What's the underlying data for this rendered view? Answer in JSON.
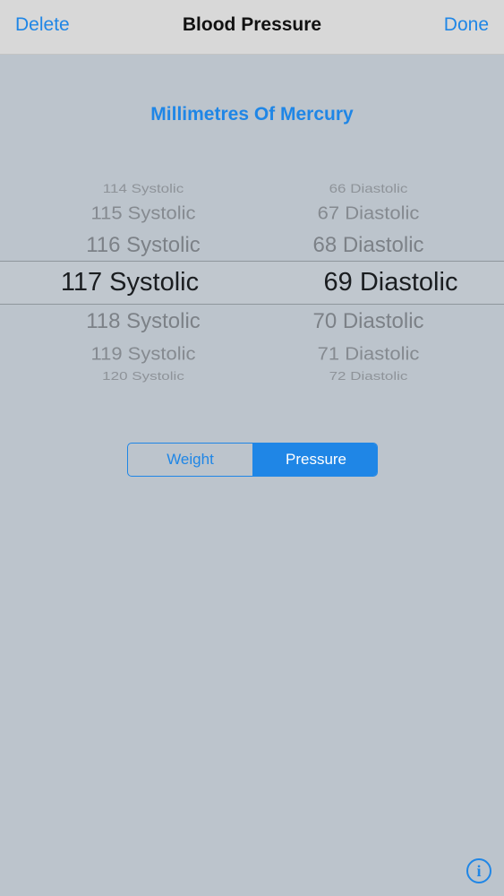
{
  "navbar": {
    "left_label": "Delete",
    "title": "Blood Pressure",
    "right_label": "Done"
  },
  "unit_label": "Millimetres Of Mercury",
  "picker": {
    "systolic": {
      "above": [
        "114 Systolic",
        "115 Systolic",
        "116 Systolic"
      ],
      "selected": "117 Systolic",
      "below": [
        "118 Systolic",
        "119 Systolic",
        "120 Systolic"
      ]
    },
    "diastolic": {
      "above": [
        "66 Diastolic",
        "67 Diastolic",
        "68 Diastolic"
      ],
      "selected": "69 Diastolic",
      "below": [
        "70 Diastolic",
        "71 Diastolic",
        "72 Diastolic"
      ]
    }
  },
  "segmented_control": {
    "options": [
      "Weight",
      "Pressure"
    ],
    "selected": "Pressure"
  },
  "info_icon": "info-circle-icon",
  "colors": {
    "accent": "#1f86e6",
    "background": "#bcc4cc",
    "navbar": "#d8d8d8"
  }
}
